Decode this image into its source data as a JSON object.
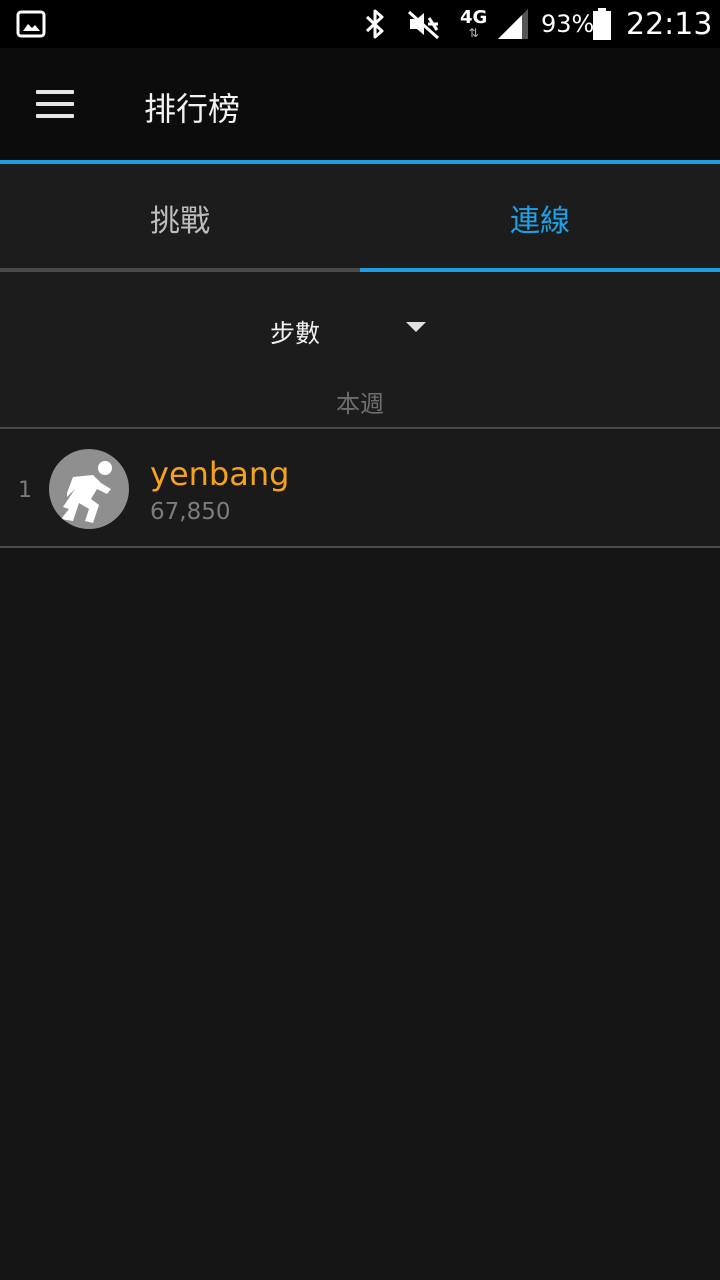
{
  "status_bar": {
    "network": "4G",
    "battery_percent": "93%",
    "time": "22:13",
    "battery_level": 0.93,
    "icons": [
      "gallery-icon",
      "bluetooth-icon",
      "mute-icon",
      "network-icon",
      "signal-icon",
      "battery-icon"
    ]
  },
  "app_bar": {
    "title": "排行榜",
    "menu_icon": "hamburger-menu-icon"
  },
  "tabs": [
    {
      "label": "挑戰",
      "selected": false
    },
    {
      "label": "連線",
      "selected": true
    }
  ],
  "filter": {
    "metric": "步數",
    "period": "本週"
  },
  "leaderboard": [
    {
      "rank": "1",
      "name": "yenbang",
      "value": "67,850",
      "avatar_icon": "runner-icon"
    }
  ],
  "colors": {
    "accent": "#1e9de0",
    "username": "#f5a21c",
    "background": "#141414"
  }
}
